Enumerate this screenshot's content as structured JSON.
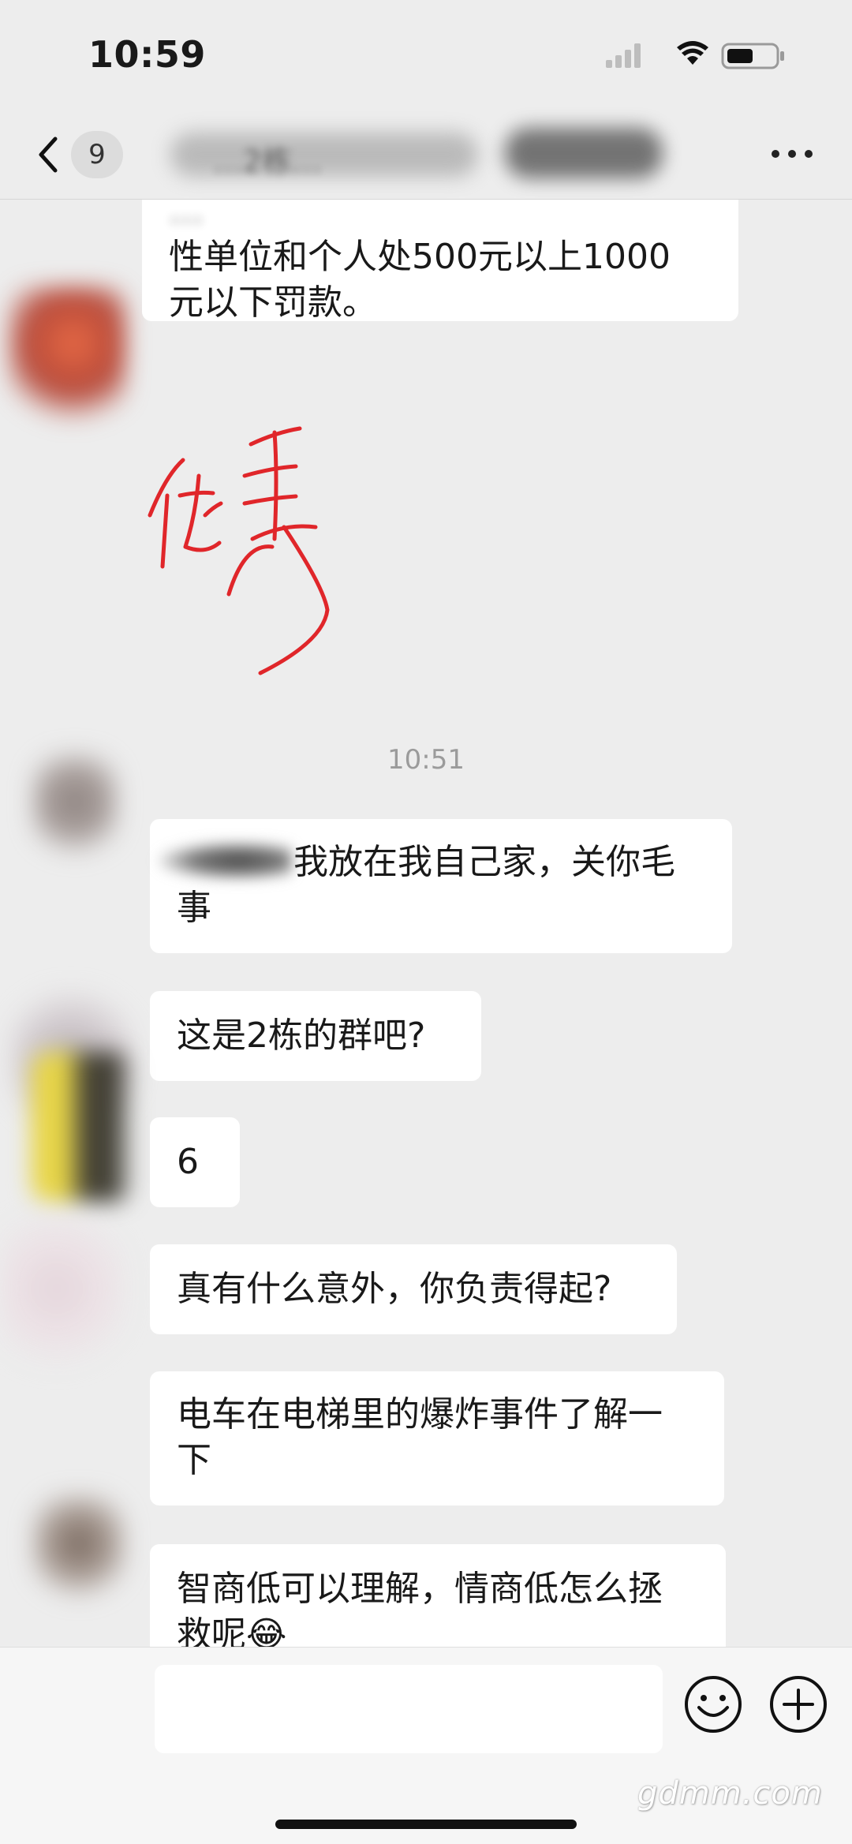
{
  "status_bar": {
    "time": "10:59",
    "icons": [
      "signal-icon",
      "wifi-icon",
      "battery-icon"
    ]
  },
  "nav": {
    "unread_count": "9",
    "title": "…2栋…"
  },
  "messages": [
    {
      "id": "m1",
      "lines": [
        "…",
        "性单位和个人处500元以上1000",
        "元以下罚款。"
      ]
    },
    {
      "id": "sig",
      "type": "handwritten-signature",
      "text": "优秀",
      "color": "#e0262a"
    },
    {
      "id": "ts",
      "type": "timestamp",
      "text": "10:51"
    },
    {
      "id": "m2",
      "lines": [
        "我放在我自己家，关你毛",
        "事"
      ]
    },
    {
      "id": "m3",
      "lines": [
        "这是2栋的群吧?"
      ]
    },
    {
      "id": "m4",
      "lines": [
        "6"
      ]
    },
    {
      "id": "m5",
      "lines": [
        "真有什么意外，你负责得起?"
      ]
    },
    {
      "id": "m6",
      "lines": [
        "电车在电梯里的爆炸事件了解一",
        "下"
      ]
    },
    {
      "id": "m7",
      "lines": [
        "智商低可以理解，情商低怎么拯",
        "救呢😂"
      ]
    }
  ],
  "input": {
    "placeholder": ""
  },
  "watermark": "gdmm.com",
  "colors": {
    "background": "#ededed",
    "bubble": "#ffffff",
    "signature": "#e0262a",
    "timestamp": "#9b9b9b"
  }
}
